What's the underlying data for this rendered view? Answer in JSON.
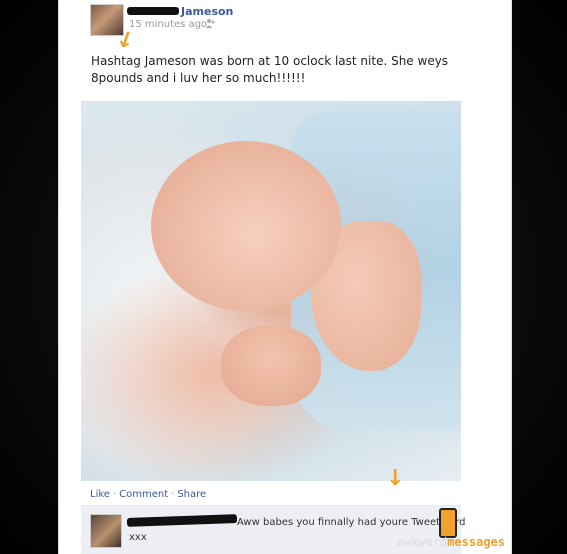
{
  "post": {
    "author": "Jameson",
    "timestamp": "15 minutes ago",
    "text": "Hashtag Jameson was born at 10 oclock last nite. She weys 8pounds and i luv her so much!!!!!!",
    "actions": {
      "like": "Like",
      "comment": "Comment",
      "share": "Share"
    }
  },
  "comment": {
    "text_line1": "Aww babes you finnally had youre Tweetybird",
    "text_line2": "xxx"
  },
  "watermark": {
    "part1": "awkward",
    "part2": "messages"
  },
  "icons": {
    "audience": "friends-icon",
    "annotation": "arrow-down-icon",
    "phone": "phone-icon"
  },
  "colors": {
    "link": "#3b5998",
    "accent": "#f0a12b"
  }
}
